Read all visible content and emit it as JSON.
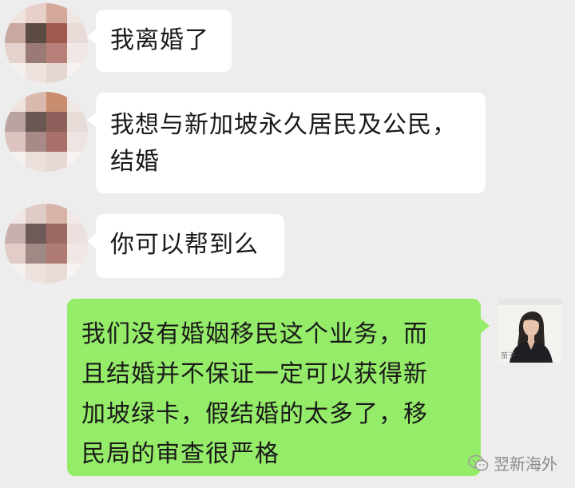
{
  "messages": [
    {
      "sender": "other",
      "lines": [
        "我离婚了"
      ]
    },
    {
      "sender": "other",
      "lines": [
        "我想与新加坡永久居民及公民，",
        "结婚"
      ]
    },
    {
      "sender": "other",
      "lines": [
        "你可以帮到么"
      ]
    },
    {
      "sender": "self",
      "lines": [
        "我们没有婚姻移民这个业务，而",
        "且结婚并不保证一定可以获得新",
        "加坡绿卡，假结婚的太多了，移",
        "民局的审查很严格"
      ]
    }
  ],
  "self_avatar": {
    "caption": "苗子"
  },
  "watermark": {
    "icon": "wechat-channel-icon",
    "text": "翌新海外"
  },
  "colors": {
    "background": "#ededed",
    "incoming_bubble": "#ffffff",
    "outgoing_bubble": "#95ec69"
  },
  "avatar_mosaics": [
    [
      "#f0e2de",
      "#e8d0c8",
      "#d4a898",
      "#f2e6e2",
      "#c9a8a0",
      "#5c4a45",
      "#a05a50",
      "#e9dcd8",
      "#e6d2cc",
      "#9a7a74",
      "#b88078",
      "#f1e7e4",
      "#f5efed",
      "#eee2de",
      "#e6d6d2",
      "#f7f2f0"
    ],
    [
      "#efe3e0",
      "#d9b8ae",
      "#c98e70",
      "#f0e6e2",
      "#b9a2a2",
      "#6a5754",
      "#8c5f5a",
      "#e8dcd9",
      "#dcc4c0",
      "#a88a86",
      "#a8706a",
      "#eee4e2",
      "#f6f0ee",
      "#ece0dc",
      "#e8d8d4",
      "#f8f3f1"
    ],
    [
      "#f0e6e4",
      "#e0ccc6",
      "#d8b4a8",
      "#f2e8e6",
      "#c8b0b0",
      "#6e5a58",
      "#9c6a64",
      "#ece0de",
      "#e2ccc8",
      "#a08884",
      "#b07a74",
      "#f0e6e4",
      "#f6f0ee",
      "#eee2de",
      "#eadad6",
      "#f8f4f2"
    ]
  ]
}
